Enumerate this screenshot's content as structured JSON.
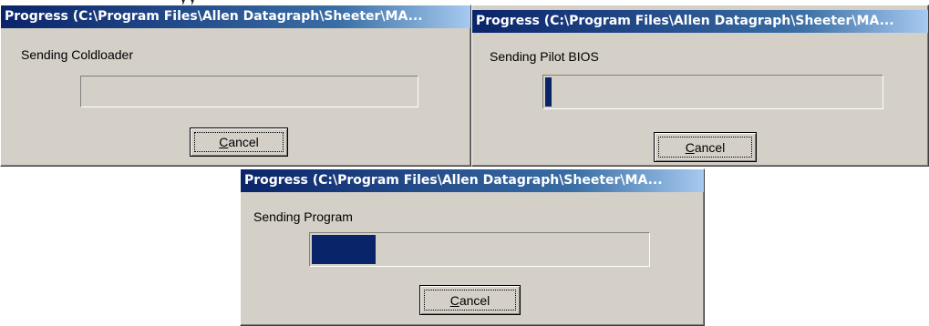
{
  "background_text": "yy",
  "colors": {
    "title_start": "#0a246a",
    "title_end": "#a6caf0",
    "dialog_face": "#d4d0c8",
    "progress_fill": "#0a246a"
  },
  "dialogs": [
    {
      "title": "Progress (C:\\Program Files\\Allen Datagraph\\Sheeter\\MA...",
      "status": "Sending Coldloader",
      "progress_fraction": 0.0,
      "cancel_mnemonic": "C",
      "cancel_rest": "ancel"
    },
    {
      "title": "Progress (C:\\Program Files\\Allen Datagraph\\Sheeter\\MA...",
      "status": "Sending Pilot BIOS",
      "progress_fraction": 0.02,
      "cancel_mnemonic": "C",
      "cancel_rest": "ancel"
    },
    {
      "title": "Progress (C:\\Program Files\\Allen Datagraph\\Sheeter\\MA...",
      "status": "Sending Program",
      "progress_fraction": 0.19,
      "cancel_mnemonic": "C",
      "cancel_rest": "ancel"
    }
  ]
}
